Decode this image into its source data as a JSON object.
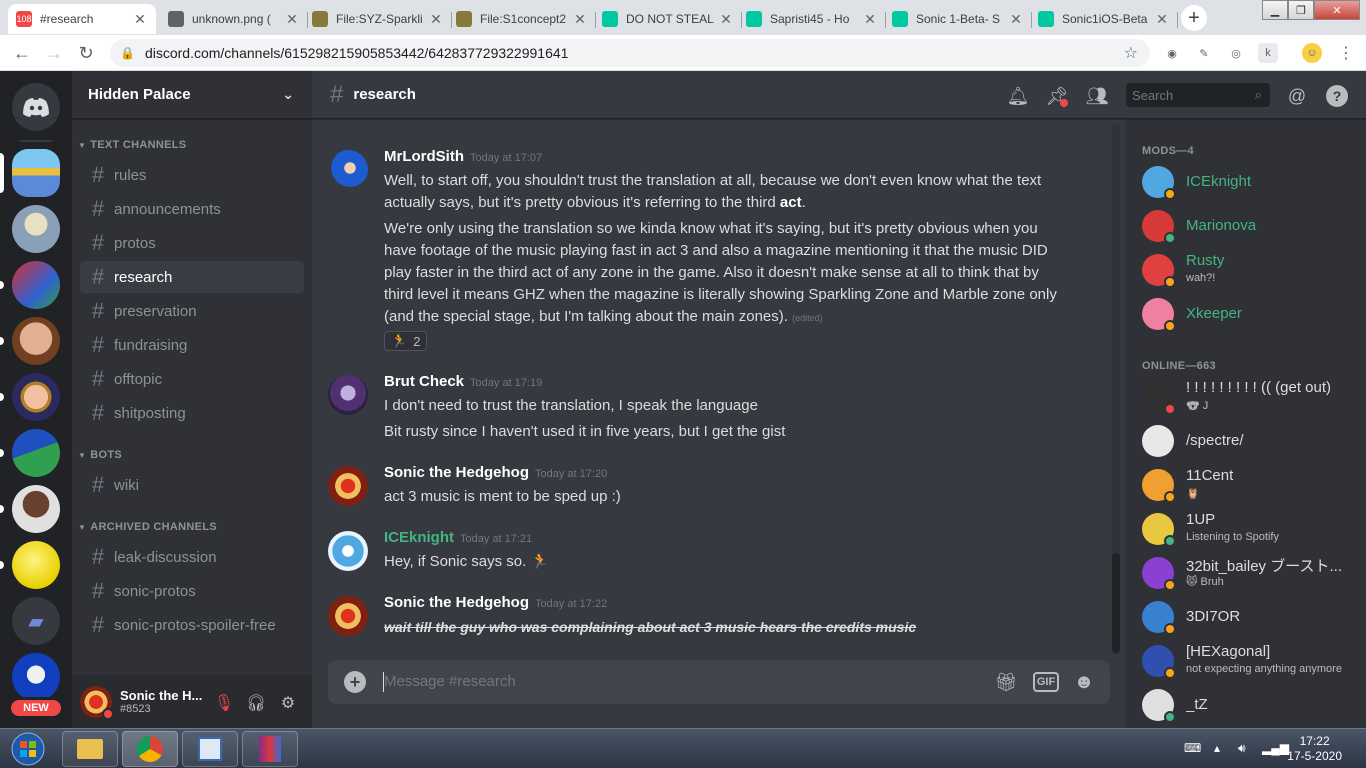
{
  "browser": {
    "tabs": [
      {
        "title": "#research",
        "active": true,
        "fav_color": "#f04747",
        "fav_icon": "discord-icon",
        "badge": "108"
      },
      {
        "title": "unknown.png (",
        "active": false,
        "fav_color": "#5f6368",
        "fav_icon": "globe-icon"
      },
      {
        "title": "File:SYZ-Sparkli",
        "active": false,
        "fav_color": "#8a7a3a",
        "fav_icon": "wiki-icon"
      },
      {
        "title": "File:S1concept2",
        "active": false,
        "fav_color": "#8a7a3a",
        "fav_icon": "wiki-icon"
      },
      {
        "title": "DO NOT STEAL",
        "active": false,
        "fav_color": "#00c8a0",
        "fav_icon": "z-icon"
      },
      {
        "title": "Sapristi45 - Ho",
        "active": false,
        "fav_color": "#00c8a0",
        "fav_icon": "z-icon"
      },
      {
        "title": "Sonic 1-Beta- S",
        "active": false,
        "fav_color": "#00c8a0",
        "fav_icon": "z-icon"
      },
      {
        "title": "Sonic1iOS-Beta",
        "active": false,
        "fav_color": "#00c8a0",
        "fav_icon": "z-icon"
      }
    ],
    "url": "discord.com/channels/615298215905853442/642837729322991641"
  },
  "server": {
    "name": "Hidden Palace",
    "categories": [
      {
        "name": "TEXT CHANNELS",
        "channels": [
          "rules",
          "announcements",
          "protos",
          "research",
          "preservation",
          "fundraising",
          "offtopic",
          "shitposting"
        ]
      },
      {
        "name": "BOTS",
        "channels": [
          "wiki"
        ]
      },
      {
        "name": "ARCHIVED CHANNELS",
        "channels": [
          "leak-discussion",
          "sonic-protos",
          "sonic-protos-spoiler-free"
        ]
      }
    ],
    "selected_channel": "research",
    "new_badge": "NEW"
  },
  "user": {
    "name": "Sonic the H...",
    "tag": "#8523"
  },
  "chat": {
    "channel": "research",
    "search_placeholder": "Search",
    "composer_placeholder": "Message #research",
    "messages": [
      {
        "author": "MrLordSith",
        "author_color": "#ffffff",
        "time": "Today at 17:07",
        "lines": [
          "Well, to start off, you shouldn't trust the translation at all, because we don't even know what the text actually says, but it's pretty obvious it's referring to the third ",
          "We're only using the translation so we kinda know what it's saying, but it's pretty obvious when you have footage of the music playing fast in act 3 and also a magazine mentioning it that the music DID play faster in the third act of any zone in the game. Also it doesn't make sense at all to think that by third level it means GHZ when the magazine is literally showing Sparkling Zone and Marble zone only (and the special stage, but I'm talking about the main zones). "
        ],
        "bold_word": "act",
        "bold_tail": ".",
        "edited": "(edited)",
        "reaction_count": "2"
      },
      {
        "author": "Brut Check",
        "author_color": "#ffffff",
        "time": "Today at 17:19",
        "lines": [
          "I don't need to trust the translation, I speak the language",
          "Bit rusty since I haven't used it in five years, but I get the gist"
        ]
      },
      {
        "author": "Sonic the Hedgehog",
        "author_color": "#ffffff",
        "time": "Today at 17:20",
        "lines": [
          "act 3 music is ment to be sped up :)"
        ]
      },
      {
        "author": "ICEknight",
        "author_color": "#43b581",
        "time": "Today at 17:21",
        "lines": [
          "Hey, if Sonic says so. "
        ]
      },
      {
        "author": "Sonic the Hedgehog",
        "author_color": "#ffffff",
        "time": "Today at 17:22",
        "lines": [
          "wait till the guy who was complaining about act 3 music hears the credits music"
        ]
      }
    ]
  },
  "members": {
    "groups": [
      {
        "label": "MODS—4",
        "members": [
          {
            "name": "ICEknight",
            "color": "#43b581",
            "status": "idle",
            "sub": ""
          },
          {
            "name": "Marionova",
            "color": "#43b581",
            "status": "mobile",
            "sub": ""
          },
          {
            "name": "Rusty",
            "color": "#43b581",
            "status": "idle",
            "sub": "wah?!"
          },
          {
            "name": "Xkeeper",
            "color": "#43b581",
            "status": "idle",
            "sub": ""
          }
        ]
      },
      {
        "label": "ONLINE—663",
        "members": [
          {
            "name": "! ! ! ! ! ! ! ! ! (( (get out)",
            "color": "#dcddde",
            "status": "dnd",
            "sub": "🐨 J"
          },
          {
            "name": "/spectre/",
            "color": "#dcddde",
            "status": "none",
            "sub": ""
          },
          {
            "name": "11Cent",
            "color": "#dcddde",
            "status": "idle",
            "sub": "🦉"
          },
          {
            "name": "1UP",
            "color": "#dcddde",
            "status": "online",
            "sub": "Listening to Spotify"
          },
          {
            "name": "32bit_bailey ブースト...",
            "color": "#dcddde",
            "status": "idle",
            "sub": "😾 Bruh"
          },
          {
            "name": "3DI7OR",
            "color": "#dcddde",
            "status": "idle",
            "sub": ""
          },
          {
            "name": "[HEXagonal]",
            "color": "#dcddde",
            "status": "idle",
            "sub": "not expecting anything anymore"
          },
          {
            "name": "_tZ",
            "color": "#dcddde",
            "status": "online",
            "sub": ""
          }
        ]
      }
    ]
  },
  "taskbar": {
    "time": "17:22",
    "date": "17-5-2020"
  },
  "colors": {
    "idle": "#faa61a",
    "online": "#43b581",
    "dnd": "#f04747",
    "mobile": "#43b581",
    "blurple": "#7289da"
  }
}
